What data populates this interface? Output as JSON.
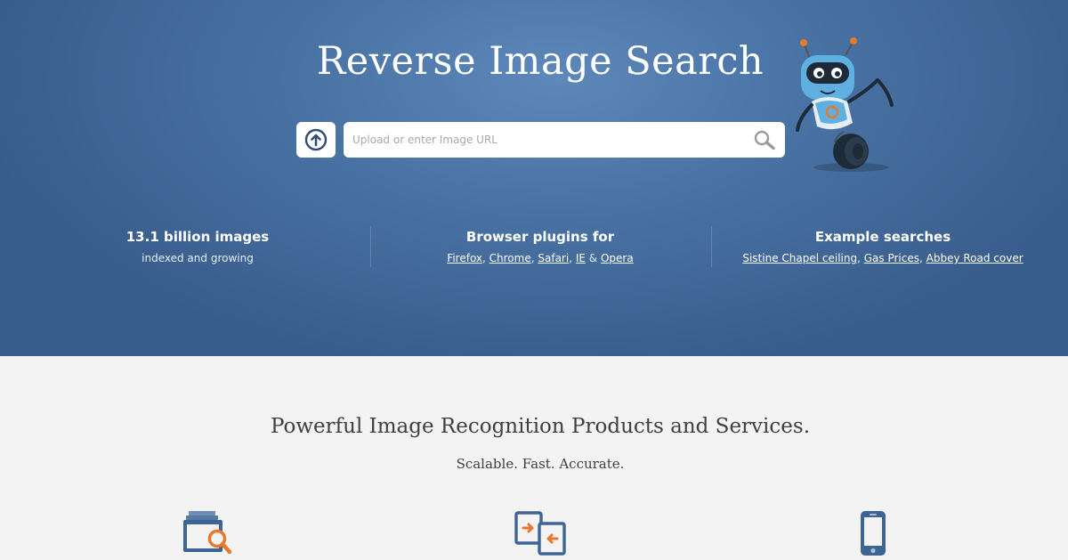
{
  "hero": {
    "title": "Reverse Image Search",
    "search": {
      "placeholder": "Upload or enter Image URL",
      "value": ""
    },
    "stats": [
      {
        "title": "13.1 billion images",
        "subtitle": "indexed and growing"
      },
      {
        "title": "Browser plugins for",
        "links": [
          "Firefox",
          "Chrome",
          "Safari",
          "IE",
          "Opera"
        ],
        "separators": [
          ", ",
          ", ",
          ", ",
          " & "
        ]
      },
      {
        "title": "Example searches",
        "links": [
          "Sistine Chapel ceiling",
          "Gas Prices",
          "Abbey Road cover"
        ],
        "separators": [
          ", ",
          ", "
        ]
      }
    ]
  },
  "products": {
    "title": "Powerful Image Recognition Products and Services.",
    "subtitle": "Scalable. Fast. Accurate.",
    "icons": [
      "image-search-icon",
      "image-compare-icon",
      "mobile-phone-icon"
    ]
  },
  "colors": {
    "hero_bg": "#4a74a6",
    "hero_bg_dark": "#385c8b",
    "lower_bg": "#f3f3f3",
    "accent_orange": "#e8782a",
    "icon_blue": "#3e6494",
    "robot_blue": "#5fb0e0"
  },
  "icons": {
    "upload": "upload-arrow-icon",
    "search": "magnifier-icon",
    "mascot": "robot-mascot"
  }
}
